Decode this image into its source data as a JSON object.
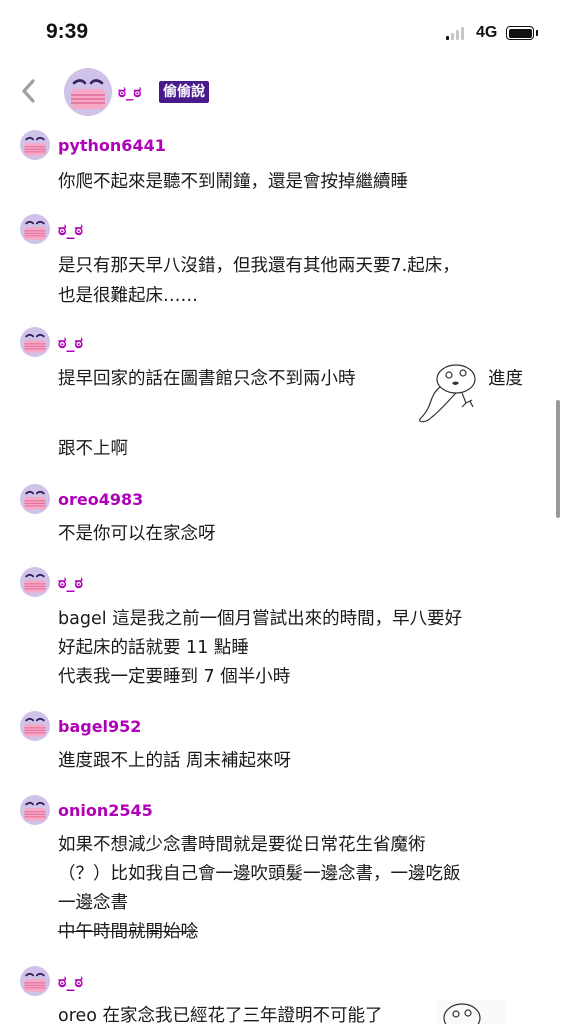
{
  "status_bar": {
    "time": "9:39",
    "network": "4G"
  },
  "header": {
    "name": "ಠ_ಠ",
    "badge": "偷偷說"
  },
  "colors": {
    "username": "#b000b8",
    "badge_bg": "#4a1a8a",
    "avatar_bg": "#cfc3ea"
  },
  "comments": [
    {
      "user": "python6441",
      "lines": [
        "你爬不起來是聽不到鬧鐘，還是會按掉繼續睡"
      ]
    },
    {
      "user": "ಠ_ಠ",
      "lines": [
        "是只有那天早八沒錯，但我還有其他兩天要7.起床，",
        "也是很難起床……"
      ]
    },
    {
      "user": "ಠ_ಠ",
      "line_a": "提早回家的話在圖書館只念不到兩小時",
      "line_a_tail": "進度",
      "line_b": "跟不上啊"
    },
    {
      "user": "oreo4983",
      "lines": [
        "不是你可以在家念呀"
      ]
    },
    {
      "user": "ಠ_ಠ",
      "lines": [
        "bagel 這是我之前一個月嘗試出來的時間，早八要好",
        "好起床的話就要 11 點睡",
        "代表我一定要睡到 7 個半小時"
      ]
    },
    {
      "user": "bagel952",
      "lines": [
        "進度跟不上的話 周末補起來呀"
      ]
    },
    {
      "user": "onion2545",
      "lines": [
        "如果不想減少念書時間就是要從日常花生省魔術",
        "（？）比如我自己會一邊吹頭髮一邊念書，一邊吃飯",
        "一邊念書"
      ],
      "struck": "中午時間就開始唸"
    },
    {
      "user": "ಠ_ಠ",
      "lines": [
        "oreo 在家念我已經花了三年證明不可能了"
      ]
    }
  ]
}
